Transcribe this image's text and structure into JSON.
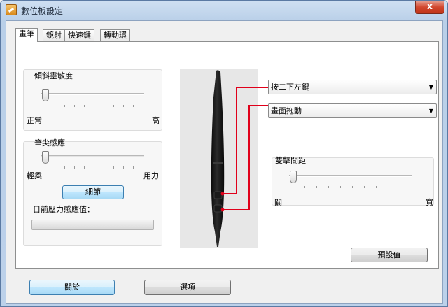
{
  "window": {
    "title": "數位板設定",
    "close_glyph": "x"
  },
  "tabs": [
    {
      "label": "畫筆"
    },
    {
      "label": "鏡射"
    },
    {
      "label": "快速鍵"
    },
    {
      "label": "轉動環"
    }
  ],
  "tilt": {
    "label": "傾斜靈敏度",
    "min_label": "正常",
    "max_label": "高",
    "level": 0.0
  },
  "tip": {
    "label": "筆尖感應",
    "min_label": "輕柔",
    "max_label": "用力",
    "level": 0.0,
    "details_button": "細節",
    "pressure_label": "目前壓力感應值：",
    "pressure_value": 0
  },
  "pen_buttons": {
    "upper": {
      "selected": "按二下左鍵"
    },
    "lower": {
      "selected": "畫面拖動"
    },
    "line_color": "#e0001a"
  },
  "double_click": {
    "label": "雙擊間距",
    "min_label": "關",
    "max_label": "寬",
    "level": 0.0
  },
  "default_button": "預設值",
  "footer": {
    "about_button": "關於",
    "options_button": "選項"
  }
}
